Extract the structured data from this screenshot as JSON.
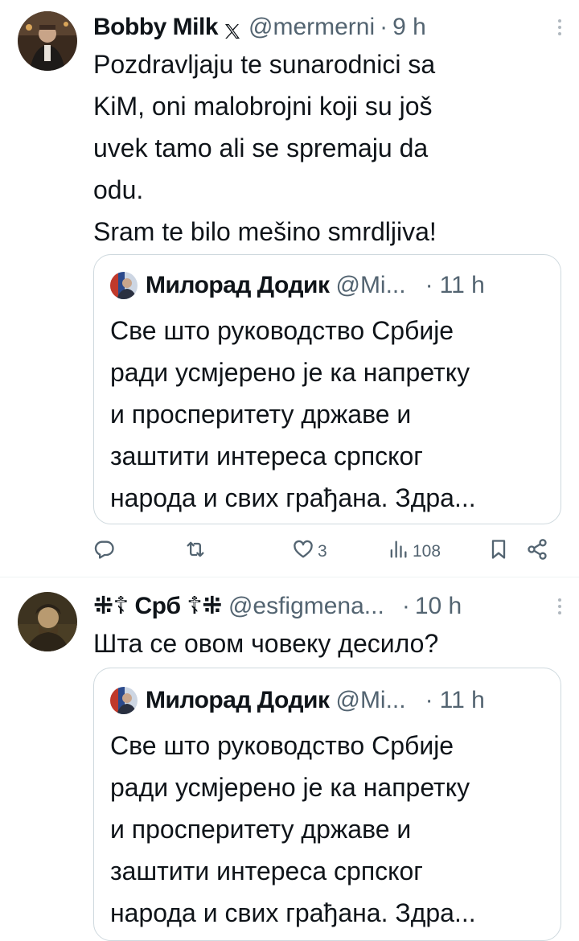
{
  "tweets": [
    {
      "author_name": "Bobby Milk",
      "handle": "@mermerni",
      "separator": "·",
      "time": "9 h",
      "text_lines": [
        "Pozdravljaju te sunarodnici sa",
        "KiM, oni malobrojni koji su još",
        "uvek tamo ali se spremaju da",
        "odu.",
        "Sram te bilo mešino smrdljiva!"
      ],
      "quote": {
        "author_name": "Милорад Додик",
        "handle": "@Mi...",
        "separator": "·",
        "time": "11 h",
        "text_lines": [
          "Све што руководство Србије",
          "ради усмјерено је ка напретку",
          "и просперитету државе и",
          "заштити интереса српског",
          "народа и свих грађана. Здра..."
        ]
      },
      "actions": {
        "reply_count": "",
        "retweet_count": "",
        "like_count": "3",
        "views_count": "108"
      }
    },
    {
      "author_name": "⁜☦ Срб ☦⁜",
      "handle": "@esfigmena...",
      "separator": "·",
      "time": "10 h",
      "text_lines": [
        "Шта се овом човеку десило?"
      ],
      "quote": {
        "author_name": "Милорад Додик",
        "handle": "@Mi...",
        "separator": "·",
        "time": "11 h",
        "text_lines": [
          "Све што руководство Србије",
          "ради усмјерено је ка напретку",
          "и просперитету државе и",
          "заштити интереса српског",
          "народа и свих грађана. Здра..."
        ]
      }
    }
  ],
  "icons": {
    "verified_badge": "x-logo-icon",
    "more": "more-dots-icon",
    "reply": "reply-icon",
    "retweet": "retweet-icon",
    "like": "heart-icon",
    "views": "views-icon",
    "bookmark": "bookmark-icon",
    "share": "share-icon"
  },
  "colors": {
    "text": "#0f1419",
    "secondary": "#536471",
    "border": "#cfd9de",
    "divider": "#eff3f4"
  }
}
